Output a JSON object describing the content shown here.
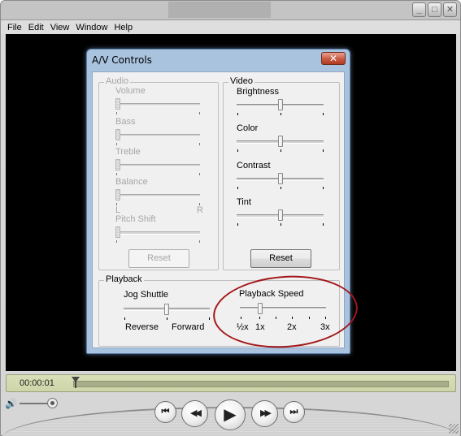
{
  "window": {
    "controls": {
      "minimize": "_",
      "maximize": "□",
      "close": "✕"
    }
  },
  "menu": [
    "File",
    "Edit",
    "View",
    "Window",
    "Help"
  ],
  "dialog": {
    "title": "A/V Controls",
    "close_icon": "✕",
    "audio": {
      "label": "Audio",
      "enabled": false,
      "sliders": [
        {
          "label": "Volume",
          "value": 0
        },
        {
          "label": "Bass",
          "value": 0
        },
        {
          "label": "Treble",
          "value": 0
        },
        {
          "label": "Balance",
          "value": 0,
          "min_label": "L",
          "max_label": "R"
        },
        {
          "label": "Pitch Shift",
          "value": 0
        }
      ],
      "reset_label": "Reset"
    },
    "video": {
      "label": "Video",
      "enabled": true,
      "sliders": [
        {
          "label": "Brightness",
          "value": 0.5
        },
        {
          "label": "Color",
          "value": 0.5
        },
        {
          "label": "Contrast",
          "value": 0.5
        },
        {
          "label": "Tint",
          "value": 0.5
        }
      ],
      "reset_label": "Reset"
    },
    "playback": {
      "label": "Playback",
      "jog_shuttle": {
        "label": "Jog Shuttle",
        "value": 0.5,
        "left_label": "Reverse",
        "right_label": "Forward"
      },
      "playback_speed": {
        "label": "Playback Speed",
        "value": "1x",
        "tick_labels": [
          "½x",
          "1x",
          "2x",
          "3x"
        ]
      }
    }
  },
  "annotation": {
    "color": "#a3171b",
    "target": "Playback Speed"
  },
  "player": {
    "time": "00:00:01",
    "progress": 0,
    "volume": 1.0,
    "buttons": {
      "prev": "⏮",
      "rewind": "◀◀",
      "play": "▶",
      "fast_forward": "▶▶",
      "next": "⏭"
    },
    "volume_icon": "🔊"
  }
}
